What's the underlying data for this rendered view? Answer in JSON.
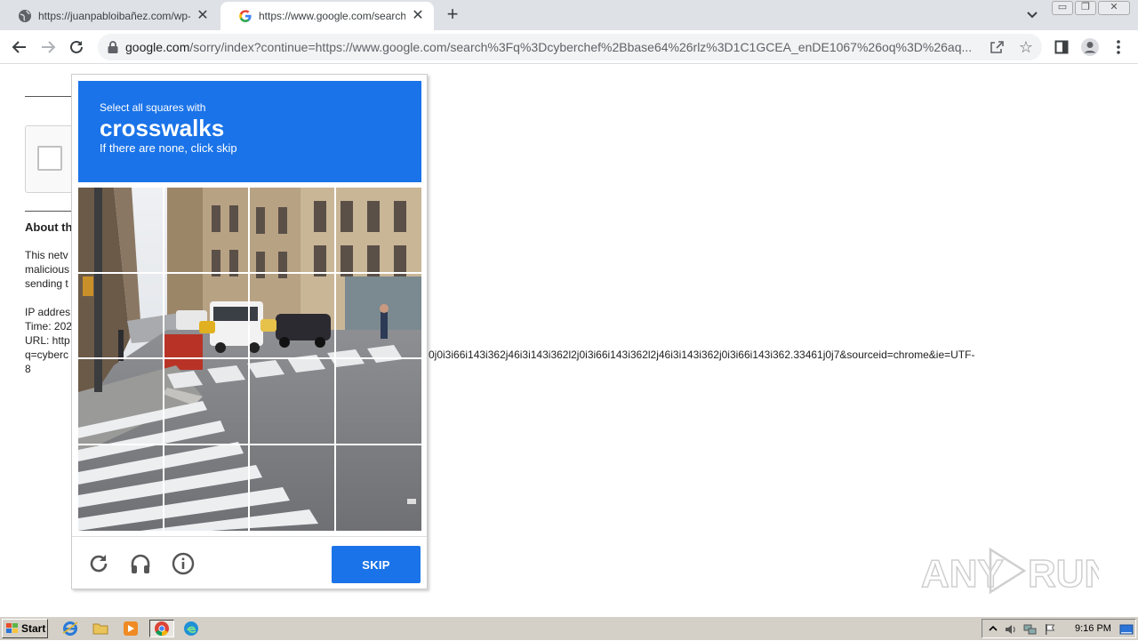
{
  "browser": {
    "tabs": [
      {
        "title": "https://juanpabloibañez.com/wp-cor",
        "favicon": "globe-icon",
        "active": false
      },
      {
        "title": "https://www.google.com/search?q=",
        "favicon": "google-g-icon",
        "active": true
      }
    ],
    "new_tab_symbol": "+",
    "close_symbol": "✕",
    "url_domain": "google.com",
    "url_rest": "/sorry/index?continue=https://www.google.com/search%3Fq%3Dcyberchef%2Bbase64%26rlz%3D1C1GCEA_enDE1067%26oq%3D%26aq..."
  },
  "page": {
    "about_heading": "About th",
    "lines": [
      "This netv",
      "malicious",
      "sending t",
      "",
      "IP addres",
      "Time: 202",
      "URL: http",
      "q=cyberc",
      "8"
    ],
    "url_tail": "0j0i3i66i143i362j46i3i143i362l2j0i3i66i143i362l2j46i3i143i362j0i3i66i143i362.33461j0j7&sourceid=chrome&ie=UTF-"
  },
  "captcha": {
    "instruction_top": "Select all squares with",
    "target_word": "crosswalks",
    "instruction_bottom": "If there are none, click skip",
    "skip_label": "SKIP",
    "footer_icons": [
      "reload-icon",
      "headphones-audio-icon",
      "info-icon"
    ],
    "grid_rows": 4,
    "grid_cols": 4
  },
  "watermark": {
    "text_left": "ANY",
    "text_right": "RUN"
  },
  "taskbar": {
    "start_label": "Start",
    "quicklaunch": [
      "internet-explorer-icon",
      "folder-icon",
      "media-player-icon",
      "chrome-icon",
      "edge-icon"
    ],
    "clock": "9:16 PM"
  }
}
